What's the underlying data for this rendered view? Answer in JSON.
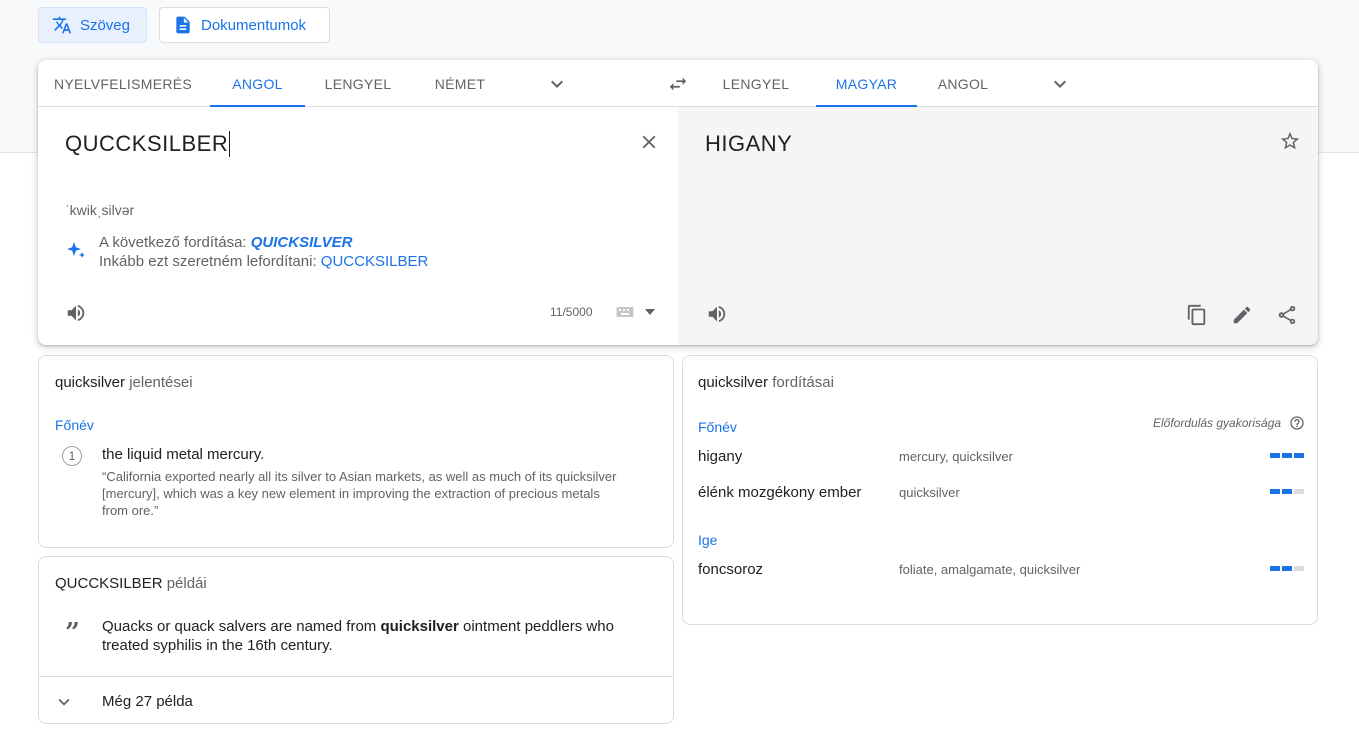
{
  "mode_buttons": {
    "text": "Szöveg",
    "documents": "Dokumentumok"
  },
  "source_tabs": [
    "NYELVFELISMERÉS",
    "ANGOL",
    "LENGYEL",
    "NÉMET"
  ],
  "target_tabs": [
    "LENGYEL",
    "MAGYAR",
    "ANGOL"
  ],
  "source": {
    "text": "QUCCKSILBER",
    "phonetic": "ˈkwikˌsilvər",
    "did_you_mean_prefix": "A következő fordítása: ",
    "did_you_mean_link": "QUICKSILVER",
    "instead_prefix": "Inkább ezt szeretném lefordítani: ",
    "instead_link": "QUCCKSILBER",
    "char_count": "11/5000"
  },
  "target": {
    "text": "HIGANY"
  },
  "definitions": {
    "title_word": "quicksilver",
    "title_suffix": " jelentései",
    "pos": "Főnév",
    "items": [
      {
        "num": "1",
        "text": "the liquid metal mercury.",
        "example": "“California exported nearly all its silver to Asian markets, as well as much of its quicksilver [mercury], which was a key new element in improving the extraction of precious metals from ore.”"
      }
    ]
  },
  "examples": {
    "title_word": "QUCCKSILBER",
    "title_suffix": " példái",
    "sentence_before": "Quacks or quack salvers are named from ",
    "sentence_bold": "quicksilver",
    "sentence_after": " ointment peddlers who treated syphilis in the 16th century.",
    "more_label": "Még 27 példa"
  },
  "translations": {
    "title_word": "quicksilver",
    "title_suffix": " fordításai",
    "frequency_label": "Előfordulás gyakorisága",
    "groups": [
      {
        "pos": "Főnév",
        "rows": [
          {
            "word": "higany",
            "synonyms": "mercury, quicksilver",
            "frequency": 3
          },
          {
            "word": "élénk mozgékony ember",
            "synonyms": "quicksilver",
            "frequency": 2
          }
        ]
      },
      {
        "pos": "Ige",
        "rows": [
          {
            "word": "foncsoroz",
            "synonyms": "foliate, amalgamate, quicksilver",
            "frequency": 2
          }
        ]
      }
    ]
  },
  "icons": {
    "text_mode": "translate-icon",
    "documents_mode": "document-icon",
    "dropdown": "chevron-down-icon",
    "swap": "swap-arrows-icon",
    "clear": "close-icon",
    "star": "star-icon",
    "speaker": "volume-icon",
    "keyboard": "keyboard-icon",
    "copy": "copy-icon",
    "edit": "pencil-icon",
    "share": "share-icon",
    "sparkle": "sparkle-icon",
    "help": "help-circle-icon",
    "quote": "quote-icon"
  },
  "colors": {
    "accent": "#1a73e8",
    "muted_text": "#5f6368",
    "target_bg": "#f5f5f5",
    "page_band": "#f8f9fa"
  }
}
